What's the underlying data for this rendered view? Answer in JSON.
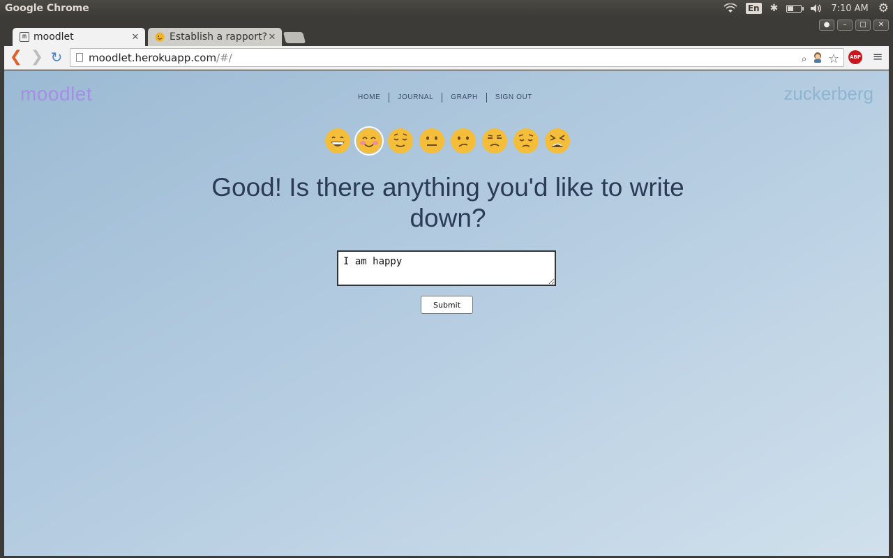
{
  "os": {
    "app_title": "Google Chrome",
    "lang": "En",
    "time": "7:10 AM",
    "battery_level": 0.4
  },
  "browser": {
    "tabs": [
      {
        "title": "moodlet",
        "favicon": "m",
        "active": true
      },
      {
        "title": "Establish a rapport?",
        "favicon": "emoji-icon",
        "active": false
      }
    ],
    "url_host": "moodlet.herokuapp.com",
    "url_path": "/#/",
    "abp_label": "ABP"
  },
  "page": {
    "brand": "moodlet",
    "user": "zuckerberg",
    "nav": [
      "HOME",
      "JOURNAL",
      "GRAPH",
      "SIGN OUT"
    ],
    "moods": [
      {
        "name": "grinning",
        "face": "#f5be3a",
        "selected": false
      },
      {
        "name": "blushing",
        "face": "#f5be3a",
        "selected": true
      },
      {
        "name": "relieved",
        "face": "#f5be3a",
        "selected": false
      },
      {
        "name": "neutral",
        "face": "#f5be3a",
        "selected": false
      },
      {
        "name": "confused",
        "face": "#f5be3a",
        "selected": false
      },
      {
        "name": "unamused",
        "face": "#f5be3a",
        "selected": false
      },
      {
        "name": "pensive",
        "face": "#f5be3a",
        "selected": false
      },
      {
        "name": "tired",
        "face": "#f5be3a",
        "selected": false
      }
    ],
    "prompt_line1": "Good! Is there anything you'd like to write",
    "prompt_line2": "down?",
    "entry_value": "I am happy",
    "submit_label": "Submit"
  }
}
